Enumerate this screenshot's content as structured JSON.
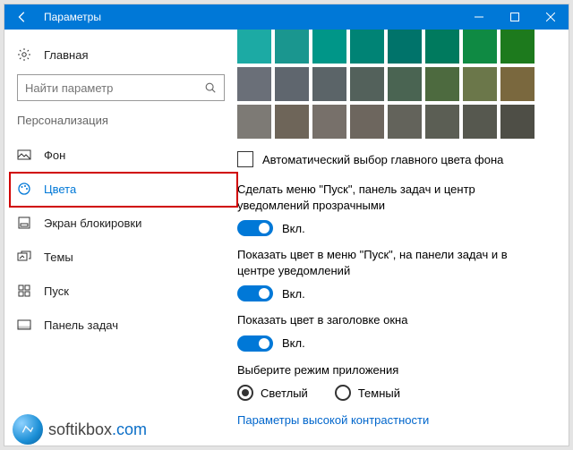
{
  "title": "Параметры",
  "home_label": "Главная",
  "search_placeholder": "Найти параметр",
  "section": "Персонализация",
  "nav": [
    {
      "label": "Фон"
    },
    {
      "label": "Цвета"
    },
    {
      "label": "Экран блокировки"
    },
    {
      "label": "Темы"
    },
    {
      "label": "Пуск"
    },
    {
      "label": "Панель задач"
    }
  ],
  "palette": {
    "rows": [
      [
        "#1caaa4",
        "#1a968f",
        "#009688",
        "#008375",
        "#00736a",
        "#007a5e",
        "#0f8a43",
        "#1d7a1d"
      ],
      [
        "#6a6f78",
        "#5f666e",
        "#5b6468",
        "#53615b",
        "#4a6452",
        "#4d6a3f",
        "#6b774a",
        "#7a683e"
      ],
      [
        "#7d7a75",
        "#6e6559",
        "#77706a",
        "#6d665e",
        "#63635b",
        "#5b5e54",
        "#56584f",
        "#4e4e46"
      ]
    ]
  },
  "auto_color_label": "Автоматический выбор главного цвета фона",
  "s1": {
    "label": "Сделать меню \"Пуск\", панель задач и центр уведомлений прозрачными",
    "state": "Вкл."
  },
  "s2": {
    "label": "Показать цвет в меню \"Пуск\", на панели задач и в центре уведомлений",
    "state": "Вкл."
  },
  "s3": {
    "label": "Показать цвет в заголовке окна",
    "state": "Вкл."
  },
  "mode": {
    "label": "Выберите режим приложения",
    "light": "Светлый",
    "dark": "Темный"
  },
  "contrast_link": "Параметры высокой контрастности",
  "watermark": {
    "a": "softikbox",
    "b": ".com"
  }
}
